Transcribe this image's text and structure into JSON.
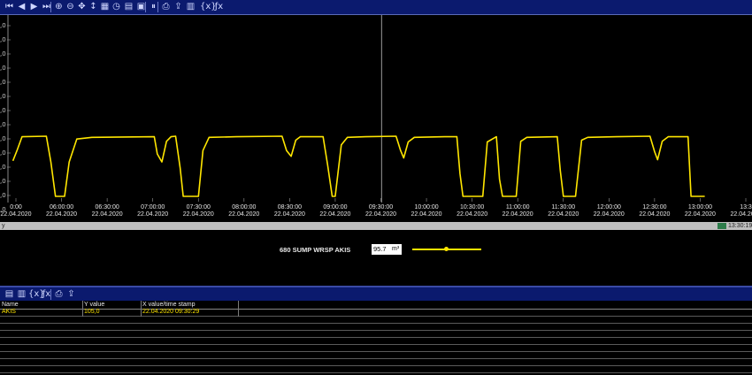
{
  "toolbar": {
    "buttons": [
      {
        "name": "first-icon",
        "glyph": "⏮"
      },
      {
        "name": "prev-icon",
        "glyph": "◀"
      },
      {
        "name": "next-icon",
        "glyph": "▶"
      },
      {
        "name": "last-icon",
        "glyph": "⏭"
      },
      {
        "name": "zoom-in-icon",
        "glyph": "⊕"
      },
      {
        "name": "zoom-out-icon",
        "glyph": "⊖"
      },
      {
        "name": "pan-icon",
        "glyph": "✥"
      },
      {
        "name": "scale-icon",
        "glyph": "↕"
      },
      {
        "name": "grid-icon",
        "glyph": "▦"
      },
      {
        "name": "clock-icon",
        "glyph": "◷"
      },
      {
        "name": "table-icon",
        "glyph": "▤"
      },
      {
        "name": "chart-settings-icon",
        "glyph": "▣"
      },
      {
        "name": "pause-icon",
        "glyph": "⏸"
      },
      {
        "name": "print-icon",
        "glyph": "⎙"
      },
      {
        "name": "export-icon",
        "glyph": "⇪"
      },
      {
        "name": "cursor-icon",
        "glyph": "▥"
      },
      {
        "name": "bracket-icon",
        "glyph": "{x}"
      },
      {
        "name": "formula-icon",
        "glyph": "ƒx"
      }
    ]
  },
  "chart_data": {
    "type": "line",
    "title": "",
    "xlabel": "",
    "ylabel": "",
    "y_tick_labels": [
      ",0",
      ",0",
      ",0",
      ",0",
      ",0",
      ",0",
      ",0",
      ",0",
      ",0",
      ",0",
      ",0",
      ",0",
      ",0",
      ",0"
    ],
    "x_ticks": [
      {
        "time": "05:30:00",
        "date": "22.04.2020",
        "shown": "0:00"
      },
      {
        "time": "06:00:00",
        "date": "22.04.2020"
      },
      {
        "time": "06:30:00",
        "date": "22.04.2020"
      },
      {
        "time": "07:00:00",
        "date": "22.04.2020"
      },
      {
        "time": "07:30:00",
        "date": "22.04.2020"
      },
      {
        "time": "08:00:00",
        "date": "22.04.2020"
      },
      {
        "time": "08:30:00",
        "date": "22.04.2020"
      },
      {
        "time": "09:00:00",
        "date": "22.04.2020"
      },
      {
        "time": "09:30:00",
        "date": "22.04.2020"
      },
      {
        "time": "10:00:00",
        "date": "22.04.2020"
      },
      {
        "time": "10:30:00",
        "date": "22.04.2020"
      },
      {
        "time": "11:00:00",
        "date": "22.04.2020"
      },
      {
        "time": "11:30:00",
        "date": "22.04.2020"
      },
      {
        "time": "12:00:00",
        "date": "22.04.2020"
      },
      {
        "time": "12:30:00",
        "date": "22.04.2020"
      },
      {
        "time": "13:00:00",
        "date": "22.04.2020"
      },
      {
        "time": "13:30:00",
        "date": "22.04.2020",
        "shown": "13:3"
      }
    ],
    "series": [
      {
        "name": "680 SUMP WRSP AKIS",
        "color": "#ffe600",
        "points": [
          [
            "05:28:00",
            62
          ],
          [
            "05:31:00",
            82
          ],
          [
            "05:34:00",
            104
          ],
          [
            "05:50:00",
            105
          ],
          [
            "05:53:00",
            60
          ],
          [
            "05:56:00",
            0
          ],
          [
            "06:02:00",
            0
          ],
          [
            "06:05:00",
            60
          ],
          [
            "06:10:00",
            100
          ],
          [
            "06:20:00",
            103
          ],
          [
            "07:01:00",
            104
          ],
          [
            "07:03:00",
            74
          ],
          [
            "07:06:00",
            60
          ],
          [
            "07:09:00",
            96
          ],
          [
            "07:12:00",
            104
          ],
          [
            "07:15:00",
            105
          ],
          [
            "07:18:00",
            50
          ],
          [
            "07:20:00",
            0
          ],
          [
            "07:30:00",
            0
          ],
          [
            "07:33:00",
            80
          ],
          [
            "07:37:00",
            103
          ],
          [
            "07:55:00",
            104
          ],
          [
            "08:25:00",
            105
          ],
          [
            "08:28:00",
            80
          ],
          [
            "08:31:00",
            70
          ],
          [
            "08:34:00",
            98
          ],
          [
            "08:37:00",
            104
          ],
          [
            "08:52:00",
            104
          ],
          [
            "08:55:00",
            55
          ],
          [
            "08:58:00",
            0
          ],
          [
            "09:00:00",
            0
          ],
          [
            "09:04:00",
            90
          ],
          [
            "09:08:00",
            103
          ],
          [
            "09:20:00",
            104
          ],
          [
            "09:40:00",
            105
          ],
          [
            "09:43:00",
            80
          ],
          [
            "09:45:00",
            67
          ],
          [
            "09:48:00",
            95
          ],
          [
            "09:52:00",
            103
          ],
          [
            "10:12:00",
            104
          ],
          [
            "10:20:00",
            104
          ],
          [
            "10:22:00",
            40
          ],
          [
            "10:24:00",
            0
          ],
          [
            "10:37:00",
            0
          ],
          [
            "10:40:00",
            95
          ],
          [
            "10:46:00",
            104
          ],
          [
            "10:48:00",
            30
          ],
          [
            "10:50:00",
            0
          ],
          [
            "10:59:00",
            0
          ],
          [
            "11:02:00",
            96
          ],
          [
            "11:06:00",
            103
          ],
          [
            "11:26:00",
            104
          ],
          [
            "11:28:00",
            45
          ],
          [
            "11:30:00",
            0
          ],
          [
            "11:38:00",
            0
          ],
          [
            "11:42:00",
            98
          ],
          [
            "11:46:00",
            103
          ],
          [
            "12:05:00",
            104
          ],
          [
            "12:27:00",
            105
          ],
          [
            "12:30:00",
            78
          ],
          [
            "12:32:00",
            64
          ],
          [
            "12:35:00",
            96
          ],
          [
            "12:39:00",
            104
          ],
          [
            "12:52:00",
            104
          ],
          [
            "12:54:00",
            0
          ],
          [
            "13:01:00",
            0
          ],
          [
            "13:03:00",
            0
          ]
        ]
      }
    ],
    "cursor_time": "09:30:29",
    "grid": false,
    "background": "#000000"
  },
  "statusbar": {
    "left_text": "y",
    "time": "13:30:19"
  },
  "legend": {
    "label": "680 SUMP WRSP AKIS",
    "value": "95.7",
    "unit": "m³",
    "color": "#ffe600"
  },
  "toolbar2": {
    "buttons": [
      {
        "name": "list-icon",
        "glyph": "▤"
      },
      {
        "name": "columns-icon",
        "glyph": "▥"
      },
      {
        "name": "bracket-icon",
        "glyph": "{x}"
      },
      {
        "name": "formula-icon",
        "glyph": "ƒx"
      },
      {
        "name": "print-icon",
        "glyph": "⎙"
      },
      {
        "name": "export-icon",
        "glyph": "⇪"
      }
    ]
  },
  "table": {
    "columns": [
      "Name",
      "Y value",
      "X value/time stamp"
    ],
    "rows": [
      [
        "AKIS",
        "105,0",
        "22.04.2020 09:30:29"
      ]
    ]
  }
}
